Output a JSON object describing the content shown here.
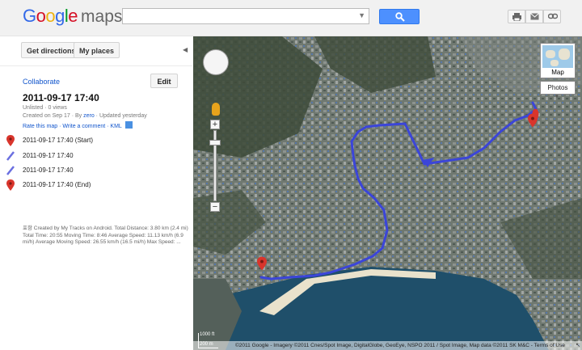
{
  "logo": {
    "brand": [
      "G",
      "o",
      "o",
      "g",
      "l",
      "e"
    ],
    "product": "maps"
  },
  "search": {
    "value": "",
    "placeholder": ""
  },
  "header_icons": [
    "print-icon",
    "email-icon",
    "link-icon"
  ],
  "toolbar": {
    "get_directions": "Get directions",
    "my_places": "My places"
  },
  "panel": {
    "collaborate": "Collaborate",
    "edit": "Edit",
    "title": "2011-09-17 17:40",
    "meta_line1": "Unlisted · 0 views",
    "meta_line2_prefix": "Created on Sep 17 · By ",
    "meta_author": "zero",
    "meta_line2_suffix": " · Updated yesterday",
    "meta_links": "Rate this map · Write a comment · KML",
    "items": [
      {
        "label": "2011-09-17 17:40 (Start)",
        "icon": "red-marker-icon"
      },
      {
        "label": "2011-09-17 17:40",
        "icon": "line-segment-icon"
      },
      {
        "label": "2011-09-17 17:40",
        "icon": "line-segment-icon"
      },
      {
        "label": "2011-09-17 17:40 (End)",
        "icon": "red-marker-icon"
      }
    ],
    "description": "포항 Created by My Tracks on Android. Total Distance: 3.80 km (2.4 mi) Total Time: 20:55 Moving Time: 8:46 Average Speed: 11.13 km/h (6.9 mi/h) Average Moving Speed: 26.55 km/h (16.5 mi/h) Max Speed: ..."
  },
  "map": {
    "map_type": "Map",
    "photos": "Photos",
    "zoom_plus": "+",
    "zoom_minus": "−",
    "scale_top": "1000 ft",
    "scale_bottom": "200 m",
    "attribution": "©2011 Google - Imagery ©2011 Cnes/Spot Image, DigitalGlobe, GeoEye, NSPO 2011 / Spot Image, Map data ©2011 SK M&C - Terms of Use",
    "route_color": "#3b45d9",
    "marker_color": "#d9352c"
  }
}
